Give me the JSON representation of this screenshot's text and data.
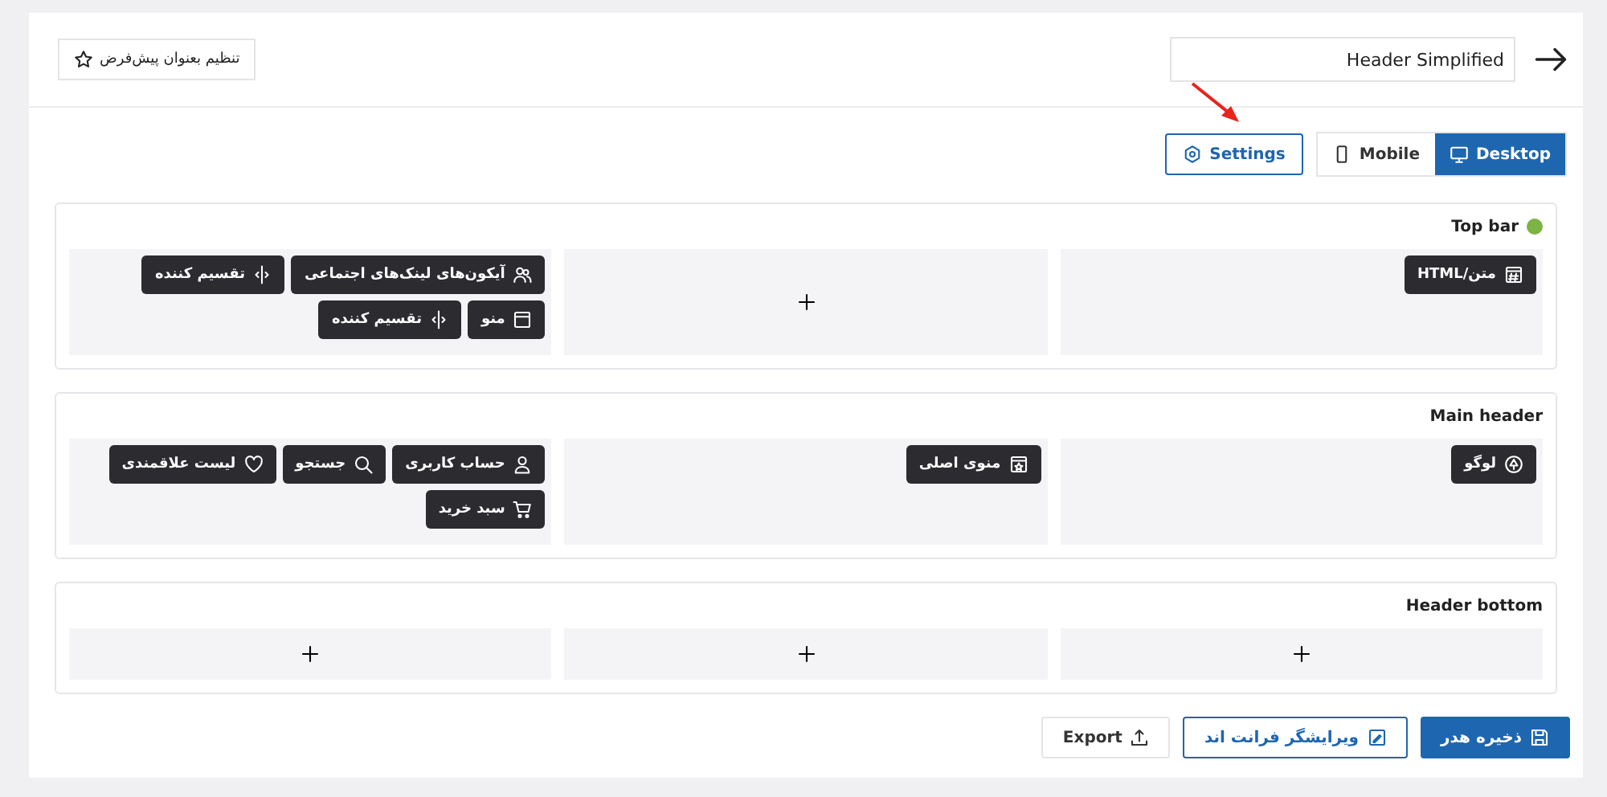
{
  "header": {
    "title_field": {
      "value": "Header Simplified"
    },
    "default_button": {
      "label": "تنظیم بعنوان پیش‌فرض"
    }
  },
  "toolbar": {
    "settings": {
      "label": "Settings"
    },
    "devices": [
      {
        "label": "Desktop",
        "kind": "desktop",
        "selected": true
      },
      {
        "label": "Mobile",
        "kind": "mobile",
        "selected": false
      }
    ]
  },
  "sections": [
    {
      "title": "Top bar",
      "color": "#7cb342",
      "slots": [
        {
          "kind": "filled",
          "items": [
            {
              "label": "متن/HTML",
              "kind": "html"
            }
          ]
        },
        {
          "kind": "empty"
        },
        {
          "kind": "filled",
          "items": [
            {
              "label": "آیکون‌های لینک‌های اجتماعی",
              "kind": "social"
            },
            {
              "label": "تقسیم کننده",
              "kind": "divider"
            },
            {
              "label": "منو",
              "kind": "menu"
            },
            {
              "label": "تقسیم کننده",
              "kind": "divider"
            }
          ]
        }
      ]
    },
    {
      "title": "Main header",
      "slots": [
        {
          "kind": "filled",
          "items": [
            {
              "label": "لوگو",
              "kind": "logo"
            }
          ]
        },
        {
          "kind": "filled",
          "items": [
            {
              "label": "منوی اصلی",
              "kind": "main-menu"
            }
          ]
        },
        {
          "kind": "filled",
          "items": [
            {
              "label": "حساب کاربری",
              "kind": "account"
            },
            {
              "label": "جستجو",
              "kind": "search"
            },
            {
              "label": "لیست علاقمندی",
              "kind": "wishlist"
            },
            {
              "label": "سبد خرید",
              "kind": "cart"
            }
          ]
        }
      ]
    },
    {
      "title": "Header bottom",
      "slots": [
        {
          "kind": "empty"
        },
        {
          "kind": "empty"
        },
        {
          "kind": "empty"
        }
      ]
    }
  ],
  "footer": [
    {
      "label": "ذخیره هدر",
      "kind": "save"
    },
    {
      "label": "ویرایشگر فرانت اند",
      "kind": "editor"
    },
    {
      "label": "Export",
      "kind": "export"
    }
  ]
}
